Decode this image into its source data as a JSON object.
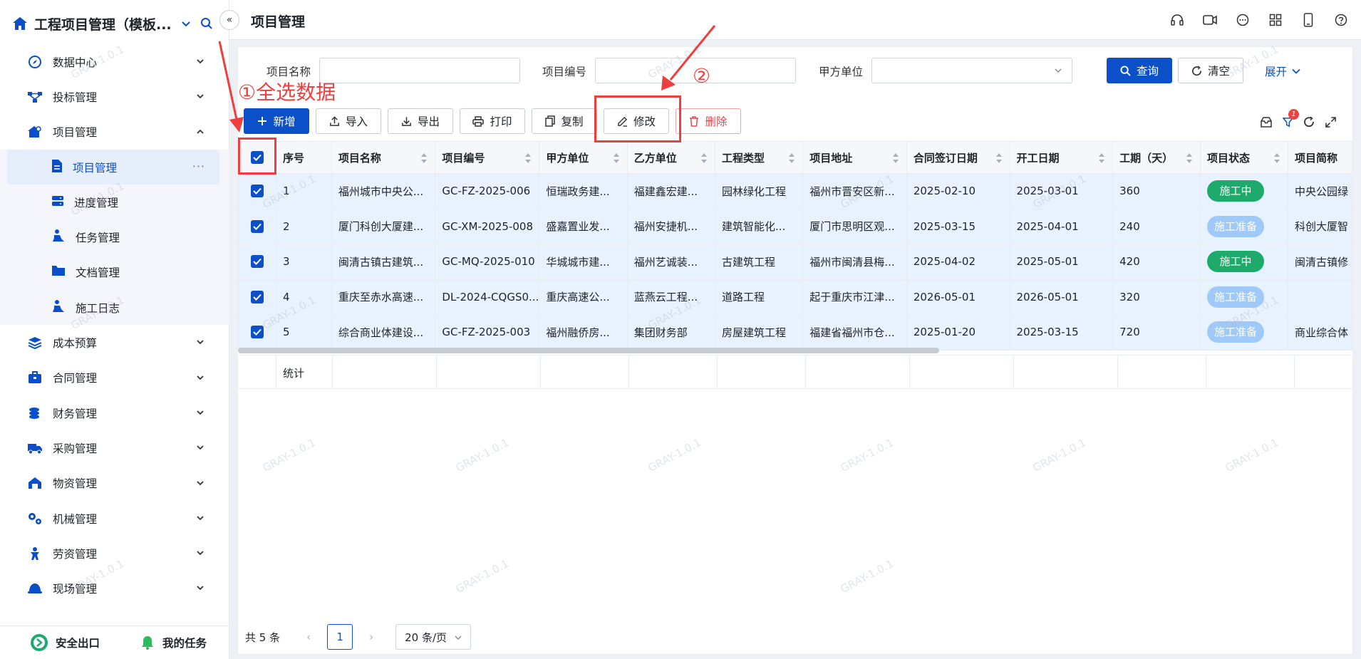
{
  "app": {
    "title": "工程项目管理（模板..."
  },
  "header": {
    "page_title": "项目管理"
  },
  "sidebar": {
    "items": [
      {
        "label": "数据中心"
      },
      {
        "label": "投标管理"
      },
      {
        "label": "项目管理"
      },
      {
        "label": "成本预算"
      },
      {
        "label": "合同管理"
      },
      {
        "label": "财务管理"
      },
      {
        "label": "采购管理"
      },
      {
        "label": "物资管理"
      },
      {
        "label": "机械管理"
      },
      {
        "label": "劳资管理"
      },
      {
        "label": "现场管理"
      }
    ],
    "subitems": [
      {
        "label": "项目管理"
      },
      {
        "label": "进度管理"
      },
      {
        "label": "任务管理"
      },
      {
        "label": "文档管理"
      },
      {
        "label": "施工日志"
      }
    ],
    "footer": {
      "exit": "安全出口",
      "tasks": "我的任务"
    }
  },
  "filter": {
    "name_label": "项目名称",
    "code_label": "项目编号",
    "party_a_label": "甲方单位",
    "query": "查询",
    "clear": "清空",
    "expand": "展开"
  },
  "toolbar": {
    "add": "新增",
    "import": "导入",
    "export": "导出",
    "print": "打印",
    "copy": "复制",
    "edit": "修改",
    "delete": "删除",
    "filter_badge": "1"
  },
  "table": {
    "columns": [
      "序号",
      "项目名称",
      "项目编号",
      "甲方单位",
      "乙方单位",
      "工程类型",
      "项目地址",
      "合同签订日期",
      "开工日期",
      "工期（天）",
      "项目状态",
      "项目简称"
    ],
    "rows": [
      [
        "1",
        "福州城市中央公...",
        "GC-FZ-2025-006",
        "恒瑞政务建...",
        "福建鑫宏建...",
        "园林绿化工程",
        "福州市晋安区新...",
        "2025-02-10",
        "2025-03-01",
        "360",
        "施工中",
        "中央公园绿"
      ],
      [
        "2",
        "厦门科创大厦建...",
        "GC-XM-2025-008",
        "盛嘉置业发...",
        "福州安捷机...",
        "建筑智能化...",
        "厦门市思明区观...",
        "2025-03-15",
        "2025-04-01",
        "240",
        "施工准备",
        "科创大厦智"
      ],
      [
        "3",
        "闽清古镇古建筑...",
        "GC-MQ-2025-010",
        "华城城市建...",
        "福州艺诚装...",
        "古建筑工程",
        "福州市闽清县梅...",
        "2025-04-02",
        "2025-05-01",
        "420",
        "施工中",
        "闽清古镇修"
      ],
      [
        "4",
        "重庆至赤水高速...",
        "DL-2024-CQGS0...",
        "重庆高速公...",
        "蓝燕云工程...",
        "道路工程",
        "起于重庆市江津...",
        "2026-05-01",
        "2026-05-01",
        "320",
        "施工准备",
        ""
      ],
      [
        "5",
        "综合商业体建设...",
        "GC-FZ-2025-003",
        "福州融侨房...",
        "集团财务部",
        "房屋建筑工程",
        "福建省福州市仓...",
        "2025-01-20",
        "2025-03-15",
        "720",
        "施工准备",
        "商业综合体"
      ]
    ],
    "summary_label": "统计"
  },
  "pager": {
    "total": "共 5 条",
    "page": "1",
    "size": "20 条/页"
  },
  "watermark": "GRAY-1.0.1",
  "annotations": {
    "step1": "①全选数据",
    "step2": "②"
  },
  "colors": {
    "primary": "#0b50c8",
    "annotation": "#ee3e3e",
    "status_running": "#1eaa6b",
    "status_prep": "#9ec9f8"
  }
}
